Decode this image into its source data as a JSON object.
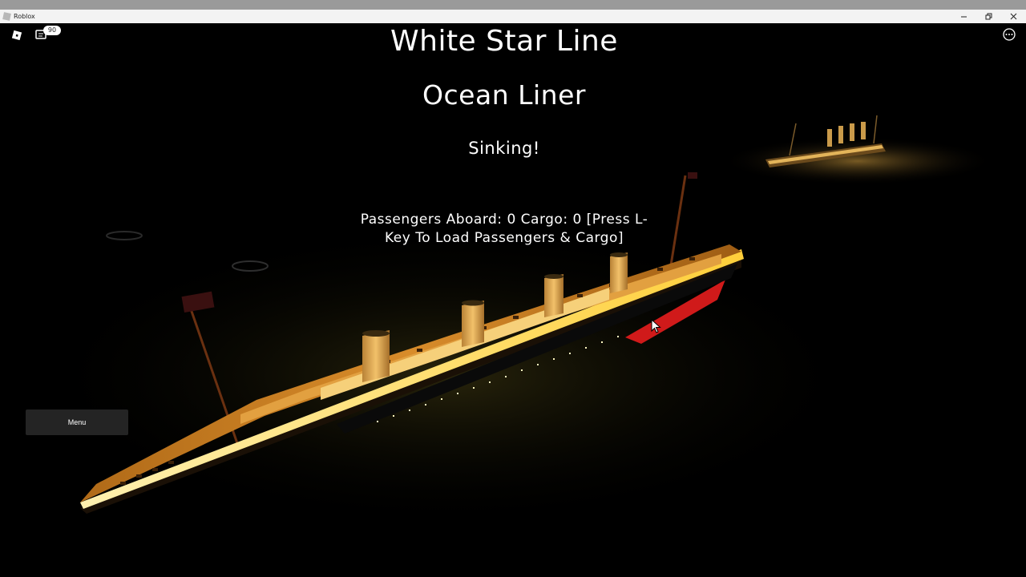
{
  "window": {
    "title": "Roblox",
    "controls": [
      "minimize",
      "restore",
      "close"
    ]
  },
  "topbar": {
    "home_icon": "roblox-logo-icon",
    "chat_icon": "chat-icon",
    "chat_badge": "90",
    "more_icon": "more-options-icon"
  },
  "hud": {
    "company": "White Star Line",
    "ship_class": "Ocean Liner",
    "status": "Sinking!",
    "passengers": "Passengers Aboard: 0 Cargo: 0 [Press L-Key To Load Passengers & Cargo]"
  },
  "menu": {
    "label": "Menu"
  },
  "colors": {
    "sky": "#000000",
    "hull_glow": "#ffd24a",
    "deck": "#c9781f",
    "funnel": "#d8a04a",
    "hull_red": "#d01a1a",
    "menu_bg": "#282828"
  }
}
